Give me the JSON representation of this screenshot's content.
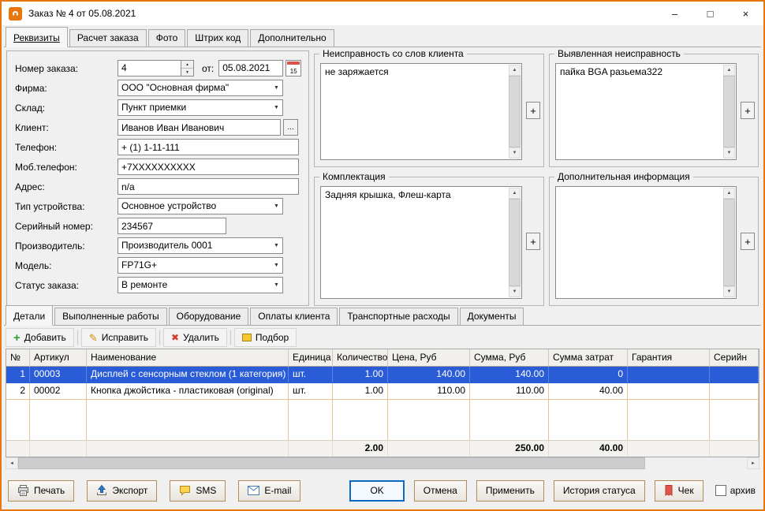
{
  "window": {
    "title": "Заказ № 4 от 05.08.2021",
    "controls": {
      "minimize": "–",
      "maximize": "□",
      "close": "×"
    }
  },
  "icons": {
    "dropdown": "▼",
    "spin_up": "▲",
    "spin_down": "▼",
    "browse": "...",
    "plus": "+",
    "scroll_up": "▲",
    "scroll_down": "▼",
    "scroll_left": "◄",
    "scroll_right": "►",
    "add_glyph": "+",
    "edit_glyph": "✎",
    "delete_glyph": "✖"
  },
  "top_tabs": [
    {
      "label": "Реквизиты"
    },
    {
      "label": "Расчет заказа"
    },
    {
      "label": "Фото"
    },
    {
      "label": "Штрих код"
    },
    {
      "label": "Дополнительно"
    }
  ],
  "form": {
    "order_number": {
      "label": "Номер заказа:",
      "value": "4"
    },
    "date": {
      "label": "от:",
      "value": "05.08.2021",
      "calendar_day": "15"
    },
    "firm": {
      "label": "Фирма:",
      "value": "ООО \"Основная фирма\""
    },
    "warehouse": {
      "label": "Склад:",
      "value": "Пункт приемки"
    },
    "client": {
      "label": "Клиент:",
      "value": "Иванов Иван Иванович"
    },
    "phone": {
      "label": "Телефон:",
      "value": "+ (1) 1-11-111"
    },
    "mobile": {
      "label": "Моб.телефон:",
      "value": "+7XXXXXXXXXX"
    },
    "address": {
      "label": "Адрес:",
      "value": "n/a"
    },
    "device_type": {
      "label": "Тип устройства:",
      "value": "Основное устройство"
    },
    "serial": {
      "label": "Серийный номер:",
      "value": "234567"
    },
    "manufacturer": {
      "label": "Производитель:",
      "value": "Производитель 0001"
    },
    "model": {
      "label": "Модель:",
      "value": "FP71G+"
    },
    "status": {
      "label": "Статус заказа:",
      "value": "В ремонте"
    }
  },
  "groupboxes": {
    "client_fault": {
      "title": "Неисправность со слов клиента",
      "text": "не заряжается"
    },
    "detected_fault": {
      "title": "Выявленная неисправность",
      "text": "пайка BGA разьема322"
    },
    "completeness": {
      "title": "Комплектация",
      "text": "Задняя крышка, Флеш-карта"
    },
    "additional_info": {
      "title": "Дополнительная информация",
      "text": ""
    }
  },
  "bottom_tabs": [
    {
      "label": "Детали"
    },
    {
      "label": "Выполненные работы"
    },
    {
      "label": "Оборудование"
    },
    {
      "label": "Оплаты клиента"
    },
    {
      "label": "Транспортные расходы"
    },
    {
      "label": "Документы"
    }
  ],
  "toolbar": {
    "add": "Добавить",
    "edit": "Исправить",
    "delete": "Удалить",
    "pick": "Подбор"
  },
  "table": {
    "headers": [
      "№",
      "Артикул",
      "Наименование",
      "Единица",
      "Количество",
      "Цена, Руб",
      "Сумма, Руб",
      "Сумма затрат",
      "Гарантия",
      "Серийн"
    ],
    "rows": [
      {
        "num": "1",
        "article": "00003",
        "name": "Дисплей с сенсорным стеклом (1 категория)",
        "unit": "шт.",
        "qty": "1.00",
        "price": "140.00",
        "sum": "140.00",
        "cost": "0",
        "warranty": "",
        "serial": ""
      },
      {
        "num": "2",
        "article": "00002",
        "name": "Кнопка джойстика - пластиковая (original)",
        "unit": "шт.",
        "qty": "1.00",
        "price": "110.00",
        "sum": "110.00",
        "cost": "40.00",
        "warranty": "",
        "serial": ""
      }
    ],
    "totals": {
      "qty": "2.00",
      "sum": "250.00",
      "cost": "40.00"
    }
  },
  "footer": {
    "print": "Печать",
    "export": "Экспорт",
    "sms": "SMS",
    "email": "E-mail",
    "ok": "OK",
    "cancel": "Отмена",
    "apply": "Применить",
    "status_history": "История статуса",
    "receipt": "Чек",
    "archive": "архив"
  },
  "colors": {
    "accent": "#e8760d",
    "selection": "#2b5cd7",
    "focus": "#0a6ac4"
  }
}
